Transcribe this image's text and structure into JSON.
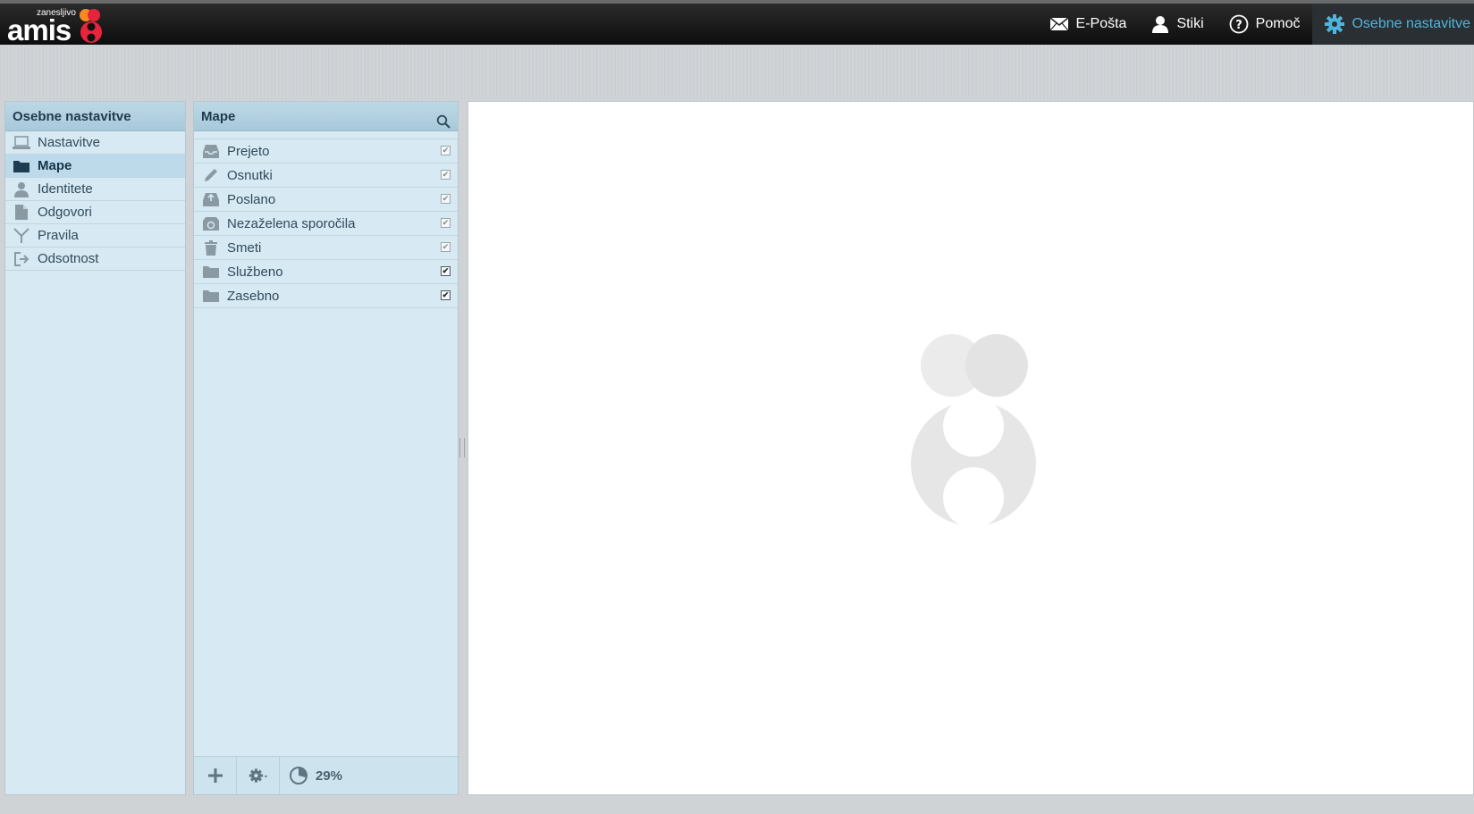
{
  "app": {
    "logo_text": "amis",
    "logo_tagline": "zanesljivo"
  },
  "topnav": [
    {
      "label": "E-Pošta",
      "icon": "envelope-icon"
    },
    {
      "label": "Stiki",
      "icon": "person-icon"
    },
    {
      "label": "Pomoč",
      "icon": "help-icon"
    },
    {
      "label": "Osebne nastavitve",
      "icon": "gear-icon",
      "active": true
    }
  ],
  "settings_panel": {
    "title": "Osebne nastavitve",
    "items": [
      {
        "label": "Nastavitve",
        "icon": "laptop-icon"
      },
      {
        "label": "Mape",
        "icon": "folder-icon",
        "selected": true
      },
      {
        "label": "Identitete",
        "icon": "person-icon"
      },
      {
        "label": "Odgovori",
        "icon": "document-icon"
      },
      {
        "label": "Pravila",
        "icon": "filter-icon"
      },
      {
        "label": "Odsotnost",
        "icon": "logout-icon"
      }
    ]
  },
  "folders_panel": {
    "title": "Mape",
    "folders": [
      {
        "label": "Prejeto",
        "icon": "inbox-icon",
        "subscribed": true,
        "locked": true
      },
      {
        "label": "Osnutki",
        "icon": "pencil-icon",
        "subscribed": true,
        "locked": true
      },
      {
        "label": "Poslano",
        "icon": "outbox-icon",
        "subscribed": true,
        "locked": true
      },
      {
        "label": "Nezaželena sporočila",
        "icon": "recycle-icon",
        "subscribed": true,
        "locked": true
      },
      {
        "label": "Smeti",
        "icon": "trash-icon",
        "subscribed": true,
        "locked": true
      },
      {
        "label": "Službeno",
        "icon": "folder-icon",
        "subscribed": true,
        "locked": false
      },
      {
        "label": "Zasebno",
        "icon": "folder-icon",
        "subscribed": true,
        "locked": false
      }
    ],
    "quota": "29%",
    "quota_fraction": 0.29
  },
  "colors": {
    "accent": "#4fb4dd",
    "panel_bg": "#d7e9f3",
    "header_bg": "#a8c9da",
    "logo_red": "#e8243c",
    "logo_orange": "#f6891f"
  }
}
